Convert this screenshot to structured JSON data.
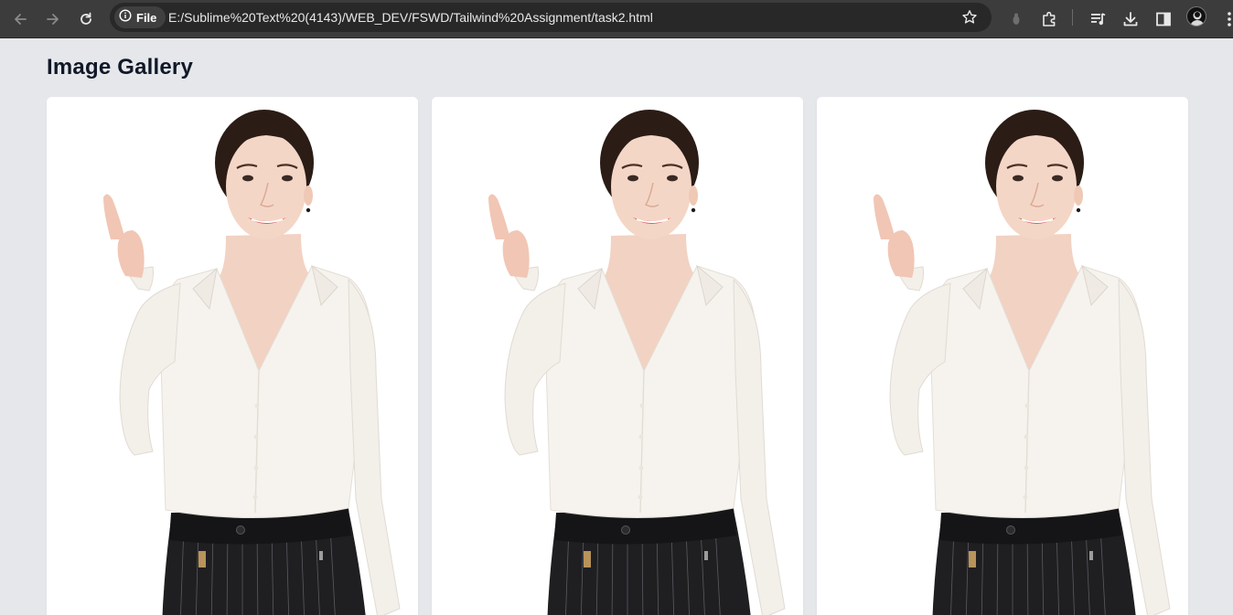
{
  "browser": {
    "security_chip_label": "File",
    "url": "E:/Sublime%20Text%20(4143)/WEB_DEV/FSWD/Tailwind%20Assignment/task2.html",
    "icons": [
      "back-icon",
      "forward-icon",
      "reload-icon",
      "info-icon",
      "star-icon",
      "extension-status-icon",
      "extensions-icon",
      "media-queue-icon",
      "download-icon",
      "side-panel-icon",
      "avatar",
      "menu-icon"
    ]
  },
  "page": {
    "title": "Image Gallery"
  },
  "gallery": {
    "items": [
      {
        "alt": "woman pointing up"
      },
      {
        "alt": "woman pointing up"
      },
      {
        "alt": "woman pointing up"
      }
    ]
  },
  "colors": {
    "page_bg": "#e5e7eb",
    "card_bg": "#ffffff",
    "toolbar_bg": "#3c3c3c",
    "omnibox_bg": "#282828"
  }
}
